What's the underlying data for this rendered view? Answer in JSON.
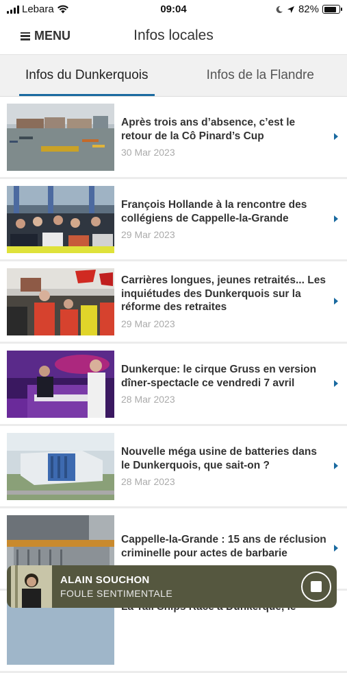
{
  "status_bar": {
    "carrier": "Lebara",
    "time": "09:04",
    "battery": "82%",
    "battery_level": 0.82
  },
  "header": {
    "menu_label": "MENU",
    "title": "Infos locales"
  },
  "tabs": [
    {
      "label": "Infos du Dunkerquois",
      "active": true
    },
    {
      "label": "Infos de la Flandre",
      "active": false
    }
  ],
  "articles": [
    {
      "title": "Après trois ans d’absence, c’est le retour de la Cô Pinard’s Cup",
      "date": "30 Mar 2023"
    },
    {
      "title": "François Hollande à la rencontre des collégiens de Cappelle-la-Grande",
      "date": "29 Mar 2023"
    },
    {
      "title": "Carrières longues, jeunes retraités... Les inquiétudes des Dunkerquois sur la réforme des retraites",
      "date": "29 Mar 2023"
    },
    {
      "title": "Dunkerque: le cirque Gruss en version dîner-spectacle ce vendredi 7 avril",
      "date": "28 Mar 2023"
    },
    {
      "title": "Nouvelle méga usine de batteries dans le Dunkerquois, que sait-on ?",
      "date": "28 Mar 2023"
    },
    {
      "title": "Cappelle-la-Grande : 15 ans de réclusion criminelle pour actes de barbarie",
      "date": ""
    },
    {
      "title": "La Tall Ships Race à Dunkerque, le",
      "date": ""
    }
  ],
  "player": {
    "artist": "ALAIN SOUCHON",
    "song": "FOULE SENTIMENTALE",
    "stop_icon": "stop-icon"
  },
  "colors": {
    "accent": "#1a6aa0",
    "player_bg": "#55573f",
    "tab_bg": "#f1f1f1"
  }
}
